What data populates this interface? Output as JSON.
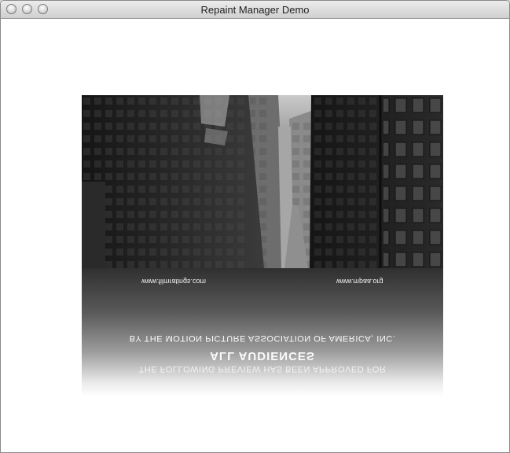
{
  "window": {
    "title": "Repaint Manager Demo",
    "buttons": [
      "close",
      "minimize",
      "zoom"
    ]
  },
  "trailer": {
    "reflection": {
      "line1": "THE FOLLOWING PREVIEW HAS BEEN APPROVED FOR",
      "line2": "ALL AUDIENCES",
      "line3": "BY THE MOTION PICTURE ASSOCIATION OF AMERICA, INC.",
      "url_left": "www.filmratings.com",
      "url_right": "www.mpaa.org"
    }
  }
}
